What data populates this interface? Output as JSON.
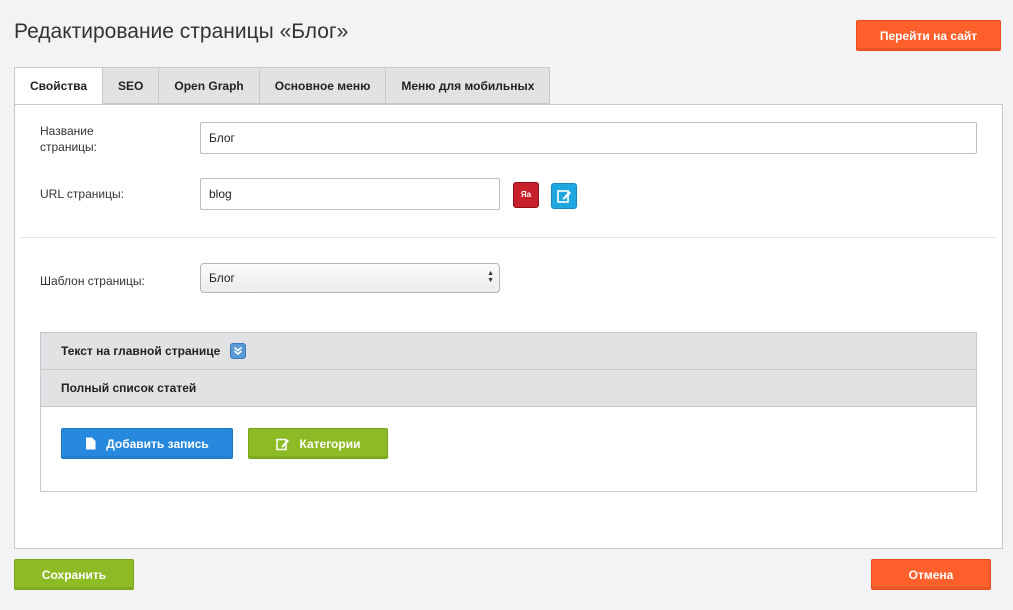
{
  "header": {
    "title": "Редактирование страницы «Блог»",
    "goto_site_label": "Перейти на сайт"
  },
  "tabs": [
    {
      "label": "Свойства",
      "active": true
    },
    {
      "label": "SEO",
      "active": false
    },
    {
      "label": "Open Graph",
      "active": false
    },
    {
      "label": "Основное меню",
      "active": false
    },
    {
      "label": "Меню для мобильных",
      "active": false
    }
  ],
  "form": {
    "page_name_label": "Название страницы:",
    "page_name_value": "Блог",
    "url_label": "URL страницы:",
    "url_value": "blog",
    "translit_icon_text": "Яа",
    "template_label": "Шаблон страницы:",
    "template_selected": "Блог"
  },
  "accordion": {
    "main_text_label": "Текст на главной странице",
    "articles_label": "Полный список статей",
    "add_record_label": "Добавить запись",
    "categories_label": "Категории"
  },
  "footer": {
    "save_label": "Сохранить",
    "cancel_label": "Отмена"
  },
  "colors": {
    "orange": "#fe5f2b",
    "green": "#8dbb25",
    "blue": "#2789dd"
  }
}
